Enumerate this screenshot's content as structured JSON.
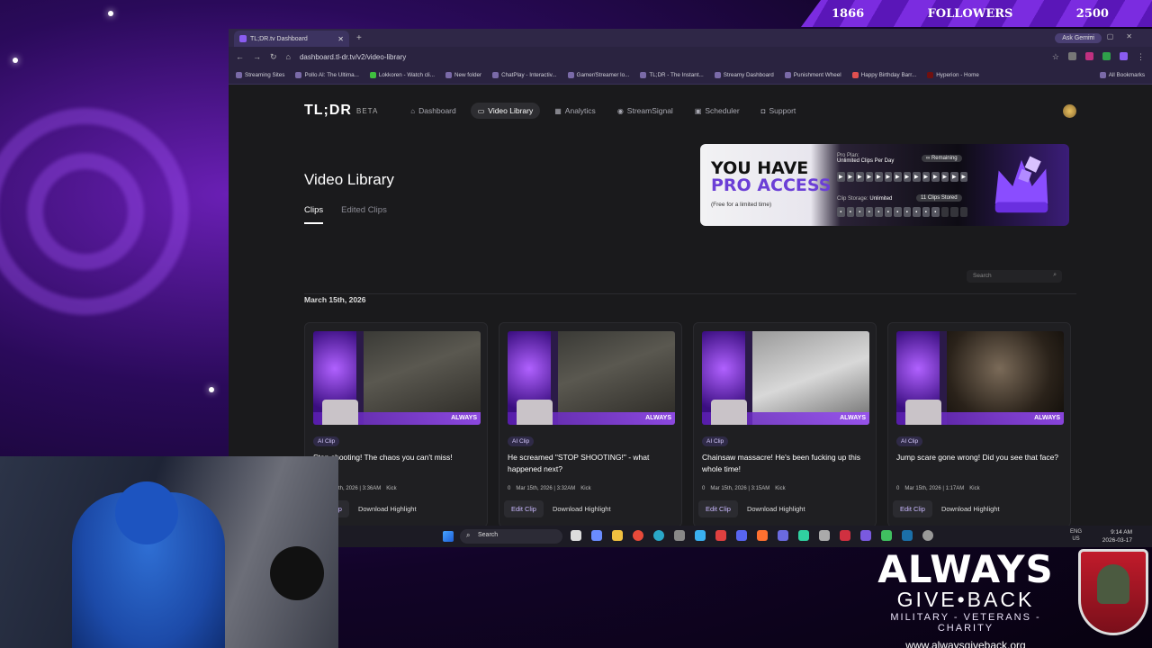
{
  "overlay": {
    "followers_count": "1866",
    "followers_label": "FOLLOWERS",
    "followers_goal": "2500",
    "logo_line1": "ALWAYS",
    "logo_line2": "GIVE•BACK",
    "logo_line3": "MILITARY - VETERANS - CHARITY",
    "website": "www.alwaysgiveback.org"
  },
  "browser": {
    "tab_title": "TL;DR.tv Dashboard",
    "url": "dashboard.tl-dr.tv/v2/video-library",
    "ask_gemini": "Ask Gemini",
    "bookmarks": [
      "Streaming Sites",
      "Pollo AI: The Ultima...",
      "Lokkoren - Watch cli...",
      "New folder",
      "ChatPlay - Interactiv...",
      "Gamer/Streamer lo...",
      "TL;DR - The Instant...",
      "Streamy Dashboard",
      "Punishment Wheel",
      "Happy Birthday Barr...",
      "Hyperion - Home"
    ],
    "all_bookmarks": "All Bookmarks"
  },
  "app": {
    "logo": "TL;DR",
    "beta": "BETA",
    "nav": [
      {
        "label": "Dashboard",
        "icon": "home-icon"
      },
      {
        "label": "Video Library",
        "icon": "video-icon"
      },
      {
        "label": "Analytics",
        "icon": "grid-icon"
      },
      {
        "label": "StreamSignal",
        "icon": "signal-icon"
      },
      {
        "label": "Scheduler",
        "icon": "calendar-icon"
      },
      {
        "label": "Support",
        "icon": "chat-icon"
      }
    ],
    "page_title": "Video Library",
    "tabs": [
      "Clips",
      "Edited Clips"
    ],
    "promo": {
      "line1": "YOU HAVE",
      "line2": "PRO ACCESS",
      "note": "(Free for a limited time)",
      "plan_label": "Pro Plan:",
      "plan_value": "Unlimited Clips Per Day",
      "remaining": "∞ Remaining",
      "storage_label": "Clip Storage:",
      "storage_value": "Unlimited",
      "stored": "11 Clips Stored"
    },
    "search_placeholder": "Search",
    "date_header": "March 15th, 2026",
    "clips": [
      {
        "badge": "AI Clip",
        "title": "Stop shooting! The chaos you can't miss!",
        "views": "0",
        "date": "Mar 15th, 2026 | 3:36AM",
        "platform": "Kick",
        "edit": "Edit Clip",
        "download": "Download Highlight"
      },
      {
        "badge": "AI Clip",
        "title": "He screamed \"STOP SHOOTING!\" - what happened next?",
        "views": "0",
        "date": "Mar 15th, 2026 | 3:32AM",
        "platform": "Kick",
        "edit": "Edit Clip",
        "download": "Download Highlight"
      },
      {
        "badge": "AI Clip",
        "title": "Chainsaw massacre! He's been fucking up this whole time!",
        "views": "0",
        "date": "Mar 15th, 2026 | 3:15AM",
        "platform": "Kick",
        "edit": "Edit Clip",
        "download": "Download Highlight"
      },
      {
        "badge": "AI Clip",
        "title": "Jump scare gone wrong! Did you see that face?",
        "views": "0",
        "date": "Mar 15th, 2026 | 1:17AM",
        "platform": "Kick",
        "edit": "Edit Clip",
        "download": "Download Highlight"
      }
    ]
  },
  "taskbar": {
    "search": "Search",
    "lang1": "ENG",
    "lang2": "US",
    "time": "9:14 AM",
    "date": "2026-03-17"
  },
  "colors": {
    "accent": "#7b2ce0",
    "pro": "#6b3fd6"
  }
}
